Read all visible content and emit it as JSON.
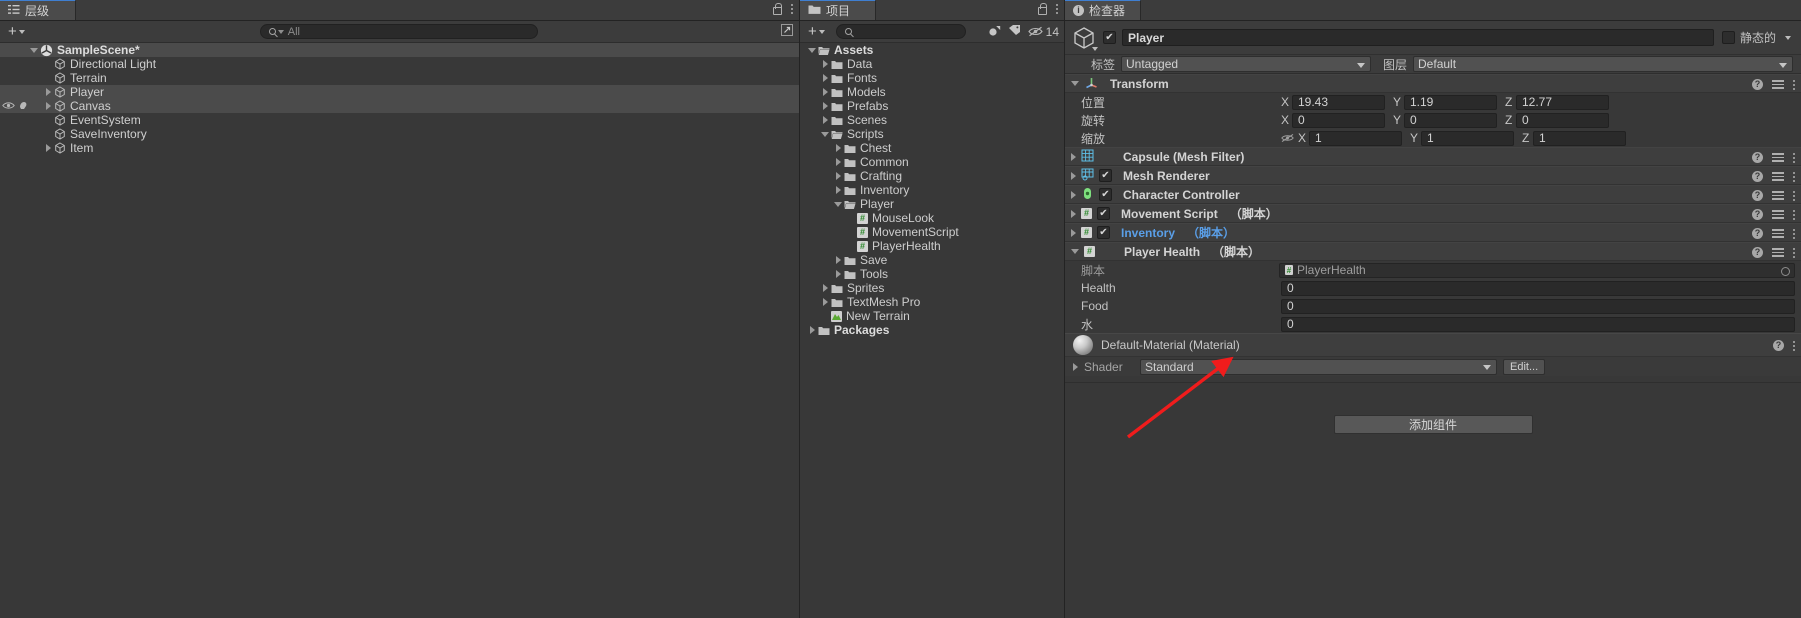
{
  "hierarchy": {
    "tab_label": "层级",
    "tab_icon": "hierarchy-icon",
    "create_label": "+",
    "search_placeholder": "All",
    "lock_icon": "lock-icon",
    "menu_icon": "kebab-menu-icon",
    "items": [
      {
        "label": "SampleScene*",
        "depth": 0,
        "icon": "unity-scene-icon",
        "expanded": true,
        "bold": true
      },
      {
        "label": "Directional Light",
        "depth": 1,
        "icon": "gameobject-icon",
        "expanded": null,
        "bold": false
      },
      {
        "label": "Terrain",
        "depth": 1,
        "icon": "gameobject-icon",
        "expanded": null,
        "bold": false
      },
      {
        "label": "Player",
        "depth": 1,
        "icon": "gameobject-icon",
        "expanded": false,
        "bold": false
      },
      {
        "label": "Canvas",
        "depth": 1,
        "icon": "gameobject-icon",
        "expanded": false,
        "bold": false
      },
      {
        "label": "EventSystem",
        "depth": 1,
        "icon": "gameobject-icon",
        "expanded": null,
        "bold": false
      },
      {
        "label": "SaveInventory",
        "depth": 1,
        "icon": "gameobject-icon",
        "expanded": null,
        "bold": false
      },
      {
        "label": "Item",
        "depth": 1,
        "icon": "gameobject-icon",
        "expanded": false,
        "bold": false
      }
    ]
  },
  "project": {
    "tab_label": "项目",
    "tab_icon": "folder-icon",
    "create_label": "+",
    "search_placeholder": "",
    "lock_icon": "lock-icon",
    "menu_icon": "kebab-menu-icon",
    "hidden_count": "14",
    "items": [
      {
        "label": "Assets",
        "depth": 0,
        "icon": "folder-open-icon",
        "expanded": true,
        "bold": true
      },
      {
        "label": "Data",
        "depth": 1,
        "icon": "folder-icon",
        "expanded": false,
        "bold": false
      },
      {
        "label": "Fonts",
        "depth": 1,
        "icon": "folder-icon",
        "expanded": false,
        "bold": false
      },
      {
        "label": "Models",
        "depth": 1,
        "icon": "folder-icon",
        "expanded": false,
        "bold": false
      },
      {
        "label": "Prefabs",
        "depth": 1,
        "icon": "folder-icon",
        "expanded": false,
        "bold": false
      },
      {
        "label": "Scenes",
        "depth": 1,
        "icon": "folder-icon",
        "expanded": false,
        "bold": false
      },
      {
        "label": "Scripts",
        "depth": 1,
        "icon": "folder-open-icon",
        "expanded": true,
        "bold": false
      },
      {
        "label": "Chest",
        "depth": 2,
        "icon": "folder-icon",
        "expanded": false,
        "bold": false
      },
      {
        "label": "Common",
        "depth": 2,
        "icon": "folder-icon",
        "expanded": false,
        "bold": false
      },
      {
        "label": "Crafting",
        "depth": 2,
        "icon": "folder-icon",
        "expanded": false,
        "bold": false
      },
      {
        "label": "Inventory",
        "depth": 2,
        "icon": "folder-icon",
        "expanded": false,
        "bold": false
      },
      {
        "label": "Player",
        "depth": 2,
        "icon": "folder-open-icon",
        "expanded": true,
        "bold": false
      },
      {
        "label": "MouseLook",
        "depth": 3,
        "icon": "script-icon",
        "expanded": null,
        "bold": false
      },
      {
        "label": "MovementScript",
        "depth": 3,
        "icon": "script-icon",
        "expanded": null,
        "bold": false
      },
      {
        "label": "PlayerHealth",
        "depth": 3,
        "icon": "script-icon",
        "expanded": null,
        "bold": false
      },
      {
        "label": "Save",
        "depth": 2,
        "icon": "folder-icon",
        "expanded": false,
        "bold": false
      },
      {
        "label": "Tools",
        "depth": 2,
        "icon": "folder-icon",
        "expanded": false,
        "bold": false
      },
      {
        "label": "Sprites",
        "depth": 1,
        "icon": "folder-icon",
        "expanded": false,
        "bold": false
      },
      {
        "label": "TextMesh Pro",
        "depth": 1,
        "icon": "folder-icon",
        "expanded": false,
        "bold": false
      },
      {
        "label": "New Terrain",
        "depth": 1,
        "icon": "terrain-icon",
        "expanded": null,
        "bold": false
      },
      {
        "label": "Packages",
        "depth": 0,
        "icon": "folder-icon",
        "expanded": false,
        "bold": true
      }
    ]
  },
  "inspector": {
    "tab_label": "检查器",
    "tab_icon": "info-icon",
    "object_enabled": true,
    "object_name": "Player",
    "static_label": "静态的",
    "static_checked": false,
    "tag_label": "标签",
    "tag_value": "Untagged",
    "layer_label": "图层",
    "layer_value": "Default",
    "transform": {
      "title": "Transform",
      "icon": "transform-icon",
      "expanded": true,
      "rows": [
        {
          "label": "位置",
          "x": "19.43",
          "y": "1.19",
          "z": "12.77",
          "lock_icon": null
        },
        {
          "label": "旋转",
          "x": "0",
          "y": "0",
          "z": "0",
          "lock_icon": null
        },
        {
          "label": "缩放",
          "x": "1",
          "y": "1",
          "z": "1",
          "lock_icon": "constrain-proportions-off-icon"
        }
      ],
      "axis_labels": [
        "X",
        "Y",
        "Z"
      ]
    },
    "components": [
      {
        "title": "Capsule (Mesh Filter)",
        "suffix": "",
        "icon": "mesh-filter-icon",
        "has_checkbox": false,
        "checked": false,
        "expanded": false,
        "link": false
      },
      {
        "title": "Mesh Renderer",
        "suffix": "",
        "icon": "mesh-renderer-icon",
        "has_checkbox": true,
        "checked": true,
        "expanded": false,
        "link": false
      },
      {
        "title": "Character Controller",
        "suffix": "",
        "icon": "character-controller-icon",
        "has_checkbox": true,
        "checked": true,
        "expanded": false,
        "link": false
      },
      {
        "title": "Movement Script",
        "suffix": "（脚本）",
        "icon": "script-icon",
        "has_checkbox": true,
        "checked": true,
        "expanded": false,
        "link": false
      },
      {
        "title": "Inventory",
        "suffix": "（脚本）",
        "icon": "script-icon",
        "has_checkbox": true,
        "checked": true,
        "expanded": false,
        "link": true
      },
      {
        "title": "Player Health",
        "suffix": "（脚本）",
        "icon": "script-icon",
        "has_checkbox": false,
        "checked": false,
        "expanded": true,
        "link": false
      }
    ],
    "player_health": {
      "script_label": "脚本",
      "script_value": "PlayerHealth",
      "fields": [
        {
          "label": "Health",
          "value": "0"
        },
        {
          "label": "Food",
          "value": "0"
        },
        {
          "label": "水",
          "value": "0"
        }
      ]
    },
    "material": {
      "title": "Default-Material (Material)",
      "shader_label": "Shader",
      "shader_value": "Standard",
      "edit_label": "Edit...",
      "icon": "material-ball-icon"
    },
    "add_component_label": "添加组件",
    "help_icon": "help-icon",
    "preset_icon": "preset-icon",
    "menu_icon": "kebab-menu-icon"
  },
  "annotation": {
    "arrow_color": "#f01c1c",
    "name": "red-arrow-annotation"
  }
}
